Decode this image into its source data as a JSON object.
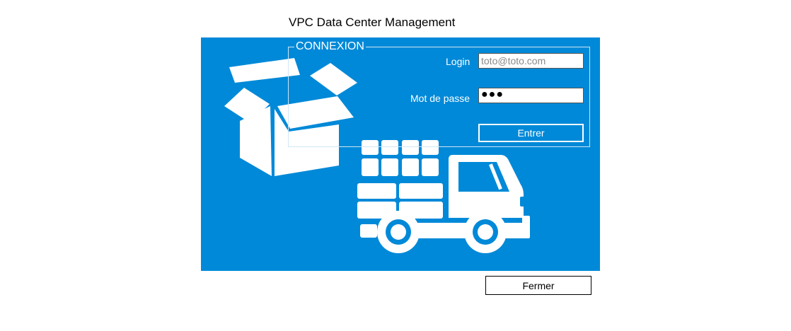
{
  "window": {
    "title": "VPC Data Center Management"
  },
  "login_panel": {
    "legend": "CONNEXION",
    "login_label": "Login",
    "login_placeholder": "toto@toto.com",
    "login_value": "",
    "password_label": "Mot de passe",
    "password_masked": "●●●",
    "enter_label": "Entrer"
  },
  "footer": {
    "close_label": "Fermer"
  },
  "colors": {
    "panel_background": "#0089d8",
    "illustration": "#ffffff"
  },
  "icons": [
    "open-box-icon",
    "delivery-truck-icon"
  ]
}
